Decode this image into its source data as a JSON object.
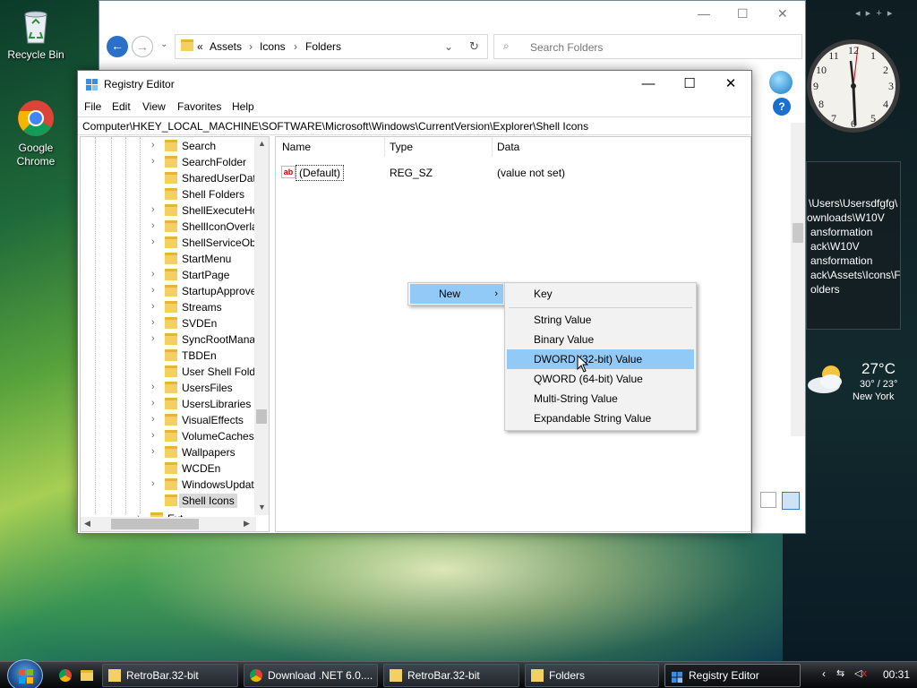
{
  "desktop": {
    "recycle_bin": "Recycle Bin",
    "chrome": "Google Chrome"
  },
  "explorer": {
    "breadcrumb": [
      "«",
      "Assets",
      "›",
      "Icons",
      "›",
      "Folders"
    ],
    "search_placeholder": "Search Folders"
  },
  "regedit": {
    "title": "Registry Editor",
    "menu": [
      "File",
      "Edit",
      "View",
      "Favorites",
      "Help"
    ],
    "path": "Computer\\HKEY_LOCAL_MACHINE\\SOFTWARE\\Microsoft\\Windows\\CurrentVersion\\Explorer\\Shell Icons",
    "tree": [
      {
        "label": "Search",
        "exp": true
      },
      {
        "label": "SearchFolder",
        "exp": true
      },
      {
        "label": "SharedUserData",
        "exp": false
      },
      {
        "label": "Shell Folders",
        "exp": false
      },
      {
        "label": "ShellExecuteHo",
        "exp": true
      },
      {
        "label": "ShellIconOverla",
        "exp": true
      },
      {
        "label": "ShellServiceObj",
        "exp": true
      },
      {
        "label": "StartMenu",
        "exp": false
      },
      {
        "label": "StartPage",
        "exp": true
      },
      {
        "label": "StartupApprove",
        "exp": true
      },
      {
        "label": "Streams",
        "exp": true
      },
      {
        "label": "SVDEn",
        "exp": true
      },
      {
        "label": "SyncRootManag",
        "exp": true
      },
      {
        "label": "TBDEn",
        "exp": false
      },
      {
        "label": "User Shell Folde",
        "exp": false
      },
      {
        "label": "UsersFiles",
        "exp": true
      },
      {
        "label": "UsersLibraries",
        "exp": true
      },
      {
        "label": "VisualEffects",
        "exp": true
      },
      {
        "label": "VolumeCaches",
        "exp": true
      },
      {
        "label": "Wallpapers",
        "exp": true
      },
      {
        "label": "WCDEn",
        "exp": false
      },
      {
        "label": "WindowsUpdate",
        "exp": true
      },
      {
        "label": "Shell Icons",
        "exp": false,
        "selected": true
      },
      {
        "label": "Ext",
        "exp": true
      }
    ],
    "columns": {
      "name": "Name",
      "type": "Type",
      "data": "Data"
    },
    "values": [
      {
        "name": "(Default)",
        "type": "REG_SZ",
        "data": "(value not set)"
      }
    ]
  },
  "context_menu": {
    "new_label": "New",
    "submenu": [
      "Key",
      "String Value",
      "Binary Value",
      "DWORD (32-bit) Value",
      "QWORD (64-bit) Value",
      "Multi-String Value",
      "Expandable String Value"
    ],
    "highlighted": "DWORD (32-bit) Value"
  },
  "gadgets": {
    "path_text": [
      "\\Users\\Usersdfgfg\\",
      "ownloads\\W10V",
      "ansformation",
      "ack\\W10V",
      "ansformation",
      "ack\\Assets\\Icons\\F",
      "olders"
    ],
    "weather_temp": "27°C",
    "weather_range": "30° / 23°",
    "weather_city": "New York"
  },
  "taskbar": {
    "buttons": [
      "RetroBar.32-bit",
      "Download .NET 6.0....",
      "RetroBar.32-bit",
      "Folders",
      "Registry Editor"
    ],
    "active": "Registry Editor",
    "time": "00:31"
  }
}
